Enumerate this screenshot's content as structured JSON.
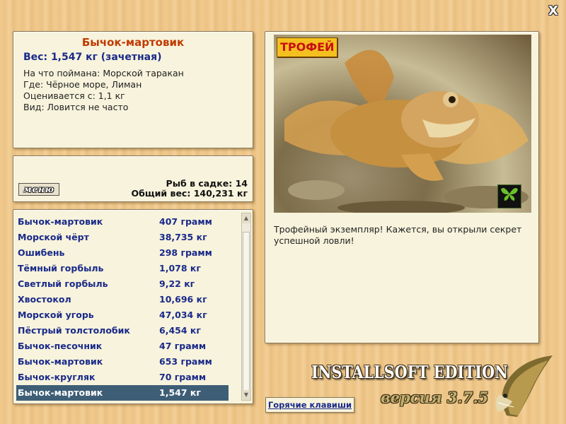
{
  "window": {
    "close_glyph": "X"
  },
  "catch_info": {
    "fish_name": "Бычок-мартовик",
    "weight_line": "Вес: 1,547 кг (зачетная)",
    "bait_line": "На что поймана: Морской таракан",
    "place_line": "Где: Чёрное море, Лиман",
    "value_line": "Оценивается с: 1,1 кг",
    "kind_line": "Вид: Ловится не часто"
  },
  "stats": {
    "menu_label": "меню",
    "fish_count": "Рыб в садке: 14",
    "total_weight": "Общий вес: 140,231 кг"
  },
  "catch_list": [
    {
      "name": "Бычок-мартовик",
      "weight": "407 грамм"
    },
    {
      "name": "Морской чёрт",
      "weight": "38,735 кг"
    },
    {
      "name": "Ошибень",
      "weight": "298 грамм"
    },
    {
      "name": "Тёмный горбыль",
      "weight": "1,078 кг"
    },
    {
      "name": "Светлый горбыль",
      "weight": "9,22 кг"
    },
    {
      "name": "Хвостокол",
      "weight": "10,696 кг"
    },
    {
      "name": "Морской угорь",
      "weight": "47,034 кг"
    },
    {
      "name": "Пёстрый толстолобик",
      "weight": "6,454 кг"
    },
    {
      "name": "Бычок-песочник",
      "weight": "47 грамм"
    },
    {
      "name": "Бычок-мартовик",
      "weight": "653 грамм"
    },
    {
      "name": "Бычок-кругляк",
      "weight": "70 грамм"
    },
    {
      "name": "Бычок-мартовик",
      "weight": "1,547 кг"
    }
  ],
  "selected_index": 11,
  "photo": {
    "trophy_badge": "ТРОФЕЙ",
    "description": "Трофейный экземпляр! Кажется, вы открыли секрет успешной ловли!"
  },
  "footer": {
    "hotkeys_label": "Горячие клавиши",
    "edition_label": "INSTALLSOFT EDITION",
    "version_label": "версия 3.7.5"
  },
  "icons": {
    "close": "close-icon",
    "butterfly": "butterfly-icon",
    "pike": "pike-logo-icon",
    "scroll_up": "scroll-up-arrow-icon",
    "scroll_down": "scroll-down-arrow-icon"
  },
  "colors": {
    "title_orange": "#c03a00",
    "text_blue": "#1a2a8a",
    "selected_row": "#3e5e76",
    "panel_bg": "#f7f3dc"
  }
}
